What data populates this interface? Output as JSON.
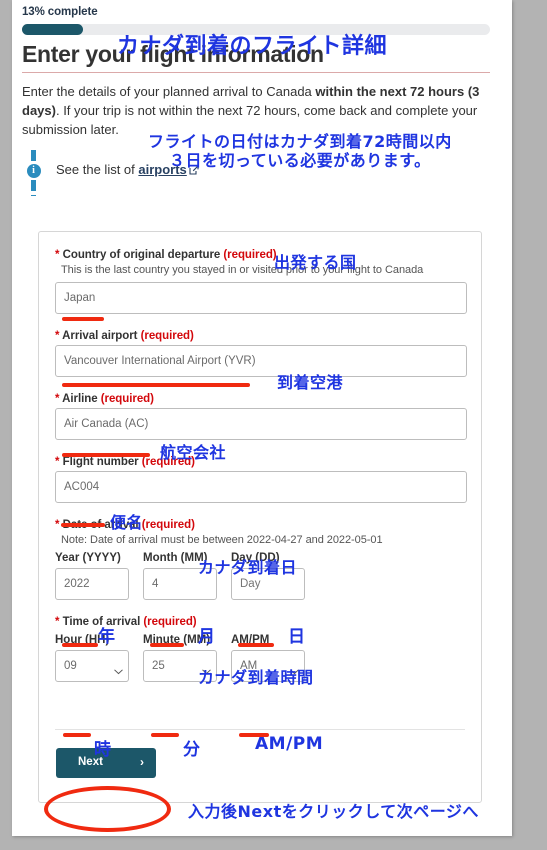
{
  "progress": {
    "label": "13% complete",
    "percent": 13,
    "fill_color": "#1c5769",
    "track_color": "#eaebed"
  },
  "header": {
    "title": "Enter your flight information",
    "lede_part1": "Enter the details of your planned arrival to Canada ",
    "lede_bold1": "within the next 72 hours (3 days)",
    "lede_part2": ". If your trip is not within the next 72 hours, come back and complete your submission later."
  },
  "callout": {
    "icon": "info-icon",
    "badge": "i",
    "text_before": "See the list of ",
    "link_label": "airports",
    "external_icon": "external-link-icon"
  },
  "form": {
    "country": {
      "label": "Country of original departure",
      "required": "(required)",
      "hint": "This is the last country you stayed in or visited prior to your flight to Canada",
      "value": "Japan"
    },
    "airport": {
      "label": "Arrival airport",
      "required": "(required)",
      "value": "Vancouver International Airport (YVR)"
    },
    "airline": {
      "label": "Airline",
      "required": "(required)",
      "value": "Air Canada (AC)"
    },
    "flight_number": {
      "label": "Flight number",
      "required": "(required)",
      "value": "AC004"
    },
    "date_of_arrival": {
      "label": "Date of arrival",
      "required": "(required)",
      "note": "Note: Date of arrival must be between 2022-04-27 and 2022-05-01",
      "year_label": "Year (YYYY)",
      "month_label": "Month (MM)",
      "day_label": "Day (DD)",
      "year_value": "2022",
      "month_value": "4",
      "day_value": "Day"
    },
    "time_of_arrival": {
      "label": "Time of arrival",
      "required": "(required)",
      "hour_label": "Hour (HH)",
      "minute_label": "Minute (MM)",
      "ampm_label": "AM/PM",
      "hour_value": "09",
      "minute_value": "25",
      "ampm_value": "AM"
    },
    "next_button": {
      "label": "Next",
      "chevron": "chevron-right-icon"
    }
  },
  "annotations": {
    "color": "#1f35e0",
    "underline_color": "#f02a10",
    "title_note": "カナダ到着のフライト詳細",
    "lede_note_line1": "フライトの日付はカナダ到着72時間以内",
    "lede_note_line2": "３日を切っている必要があります。",
    "country_note": "出発する国",
    "airport_note": "到着空港",
    "airline_note": "航空会社",
    "flight_number_note": "便名",
    "date_note": "カナダ到着日",
    "year_note": "年",
    "month_note": "月",
    "day_note": "日",
    "time_note": "カナダ到着時間",
    "hour_note": "時",
    "minute_note": "分",
    "ampm_note": "AM/PM",
    "next_note": "入力後Nextをクリックして次ページへ"
  }
}
